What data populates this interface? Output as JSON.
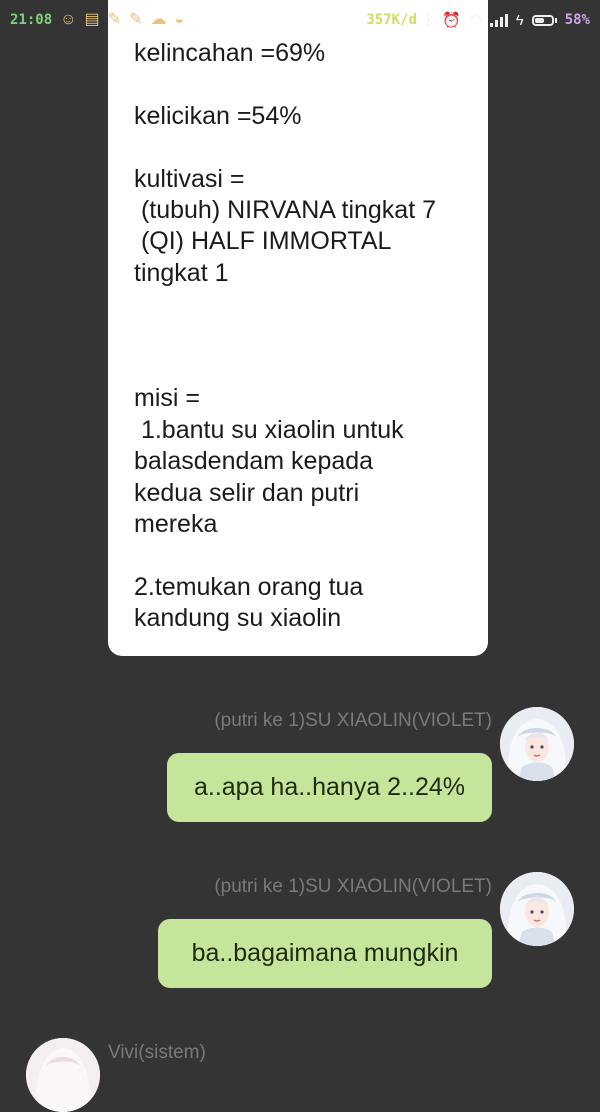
{
  "status_bar": {
    "time": "21:08",
    "notification_icons": [
      "smile-icon",
      "note-icon",
      "message-icon",
      "message-icon",
      "ghost-icon",
      "burger-icon"
    ],
    "net_speed": "357K/d",
    "battery_level": 0.58,
    "battery_text": "58%"
  },
  "card": {
    "text": "kelincahan =69%\n\nkelicikan =54%\n\nkultivasi =\n (tubuh) NIRVANA tingkat 7\n (QI) HALF IMMORTAL\ntingkat 1\n\n\n\nmisi =\n 1.bantu su xiaolin untuk\nbalasdendam kepada\nkedua selir dan putri\nmereka\n\n2.temukan orang tua\nkandung su xiaolin"
  },
  "messages": [
    {
      "sender": "(putri ke 1)SU XIAOLIN(VIOLET)",
      "text": "a..apa ha..hanya 2..24%"
    },
    {
      "sender": "(putri ke 1)SU XIAOLIN(VIOLET)",
      "text": "ba..bagaimana mungkin"
    }
  ],
  "incoming": {
    "sender": "Vivi(sistem)"
  },
  "colors": {
    "background": "#343434",
    "bubble": "#c5e69a",
    "card": "#ffffff",
    "name": "#7a7a7a"
  }
}
